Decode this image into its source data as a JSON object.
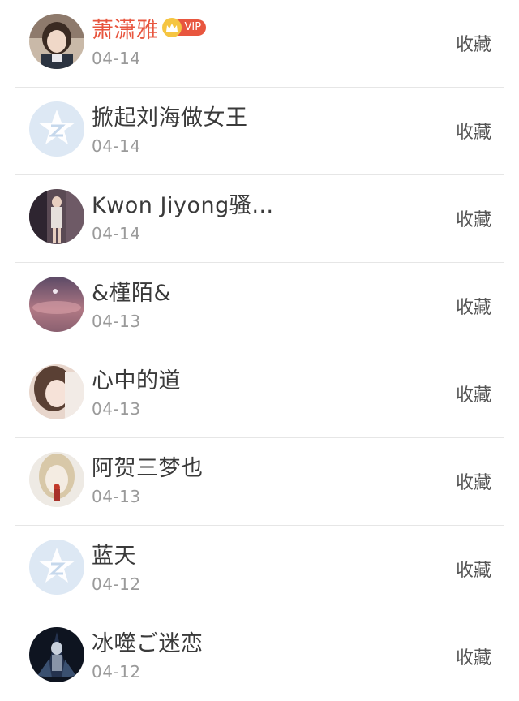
{
  "items": [
    {
      "name": "萧潇雅",
      "date": "04-14",
      "action": "收藏",
      "vip": true,
      "vip_label": "VIP",
      "avatar": "photo-girl"
    },
    {
      "name": "掀起刘海做女王",
      "date": "04-14",
      "action": "收藏",
      "vip": false,
      "avatar": "default-z-icon"
    },
    {
      "name": "Kwon Jiyong骚…",
      "date": "04-14",
      "action": "收藏",
      "vip": false,
      "avatar": "photo-person-room"
    },
    {
      "name": "&槿陌&",
      "date": "04-13",
      "action": "收藏",
      "vip": false,
      "avatar": "photo-dusk-sky"
    },
    {
      "name": "心中的道",
      "date": "04-13",
      "action": "收藏",
      "vip": false,
      "avatar": "photo-girl-selfie"
    },
    {
      "name": "阿贺三梦也",
      "date": "04-13",
      "action": "收藏",
      "vip": false,
      "avatar": "photo-pale-face"
    },
    {
      "name": "蓝天",
      "date": "04-12",
      "action": "收藏",
      "vip": false,
      "avatar": "default-z-icon"
    },
    {
      "name": "冰噬ご迷恋",
      "date": "04-12",
      "action": "收藏",
      "vip": false,
      "avatar": "photo-dark-figure"
    }
  ],
  "colors": {
    "vip_name": "#e8563f",
    "date": "#9a9a9a",
    "badge_crown": "#f5c542",
    "default_avatar_bg": "#dde8f4"
  }
}
